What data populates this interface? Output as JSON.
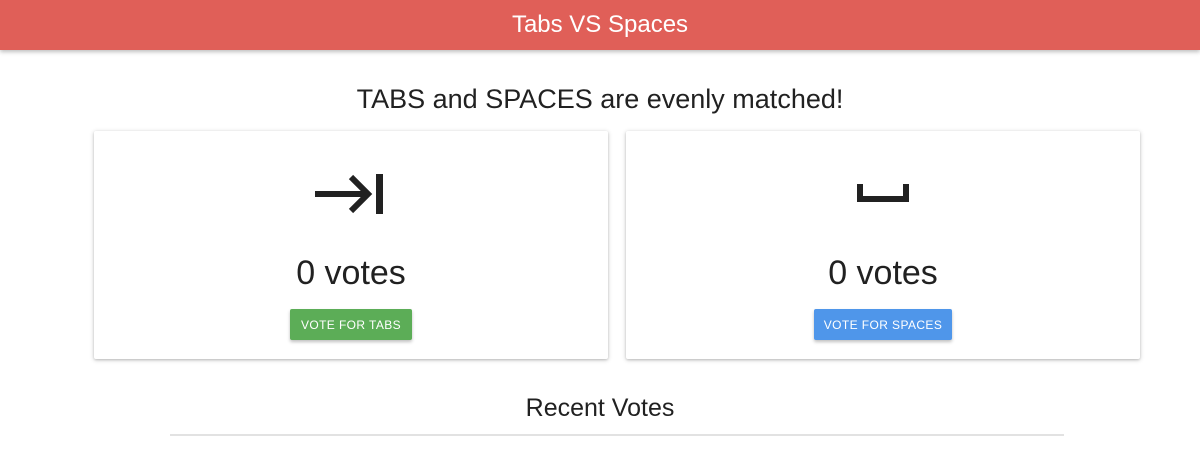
{
  "header": {
    "title": "Tabs VS Spaces",
    "color": "#e05f58"
  },
  "status": {
    "text": "TABS and SPACES are evenly matched!"
  },
  "cards": {
    "tabs": {
      "icon": "tab-arrow-icon",
      "votes_text": "0 votes",
      "button_label": "VOTE FOR TABS",
      "button_color": "#5cad57"
    },
    "spaces": {
      "icon": "space-bar-icon",
      "votes_text": "0 votes",
      "button_label": "VOTE FOR SPACES",
      "button_color": "#4f96ea"
    }
  },
  "recent": {
    "title": "Recent Votes"
  }
}
